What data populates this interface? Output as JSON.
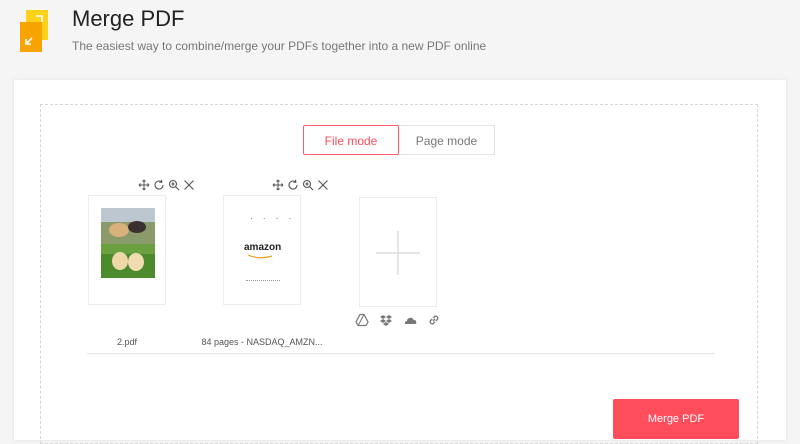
{
  "header": {
    "title": "Merge PDF",
    "subtitle": "The easiest way to combine/merge your PDFs together into a new PDF online"
  },
  "modes": {
    "file_label": "File mode",
    "page_label": "Page mode",
    "active": "file"
  },
  "files": [
    {
      "name": "2.pdf"
    },
    {
      "name": "84 pages - NASDAQ_AMZN...",
      "preview_text": "amazon"
    }
  ],
  "add_sources": [
    "google-drive-icon",
    "dropbox-icon",
    "onedrive-icon",
    "link-icon"
  ],
  "actions": {
    "merge_label": "Merge PDF"
  },
  "colors": {
    "accent": "#ff4d5b",
    "logo_yellow": "#ffc400",
    "logo_orange": "#f7a400"
  }
}
